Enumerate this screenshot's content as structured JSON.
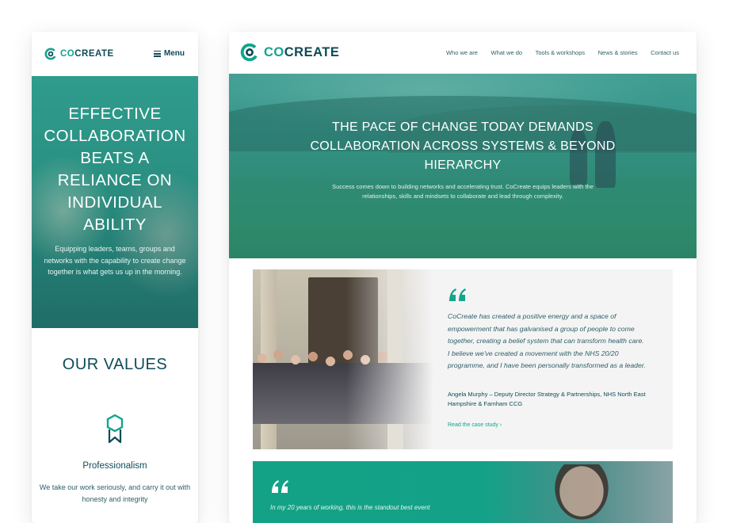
{
  "brand": {
    "logo_co": "CO",
    "logo_create": "CREATE",
    "colors": {
      "teal": "#12a58c",
      "navy": "#0e4b58",
      "hero_overlay": "#2a9082"
    }
  },
  "mobile": {
    "menu_icon": "hamburger-icon",
    "menu_label": "Menu",
    "hero_title": "EFFECTIVE COLLABORATION BEATS A RELIANCE ON INDIVIDUAL ABILITY",
    "hero_subtitle": "Equipping leaders, teams, groups and networks with the capability to create change together is what gets us up in the morning.",
    "values_title": "OUR VALUES",
    "value": {
      "icon": "award-badge-icon",
      "name": "Professionalism",
      "description": "We take our work seriously, and carry it out with honesty and integrity"
    }
  },
  "desktop": {
    "nav": [
      {
        "label": "Who we are"
      },
      {
        "label": "What we do"
      },
      {
        "label": "Tools & workshops"
      },
      {
        "label": "News & stories"
      },
      {
        "label": "Contact us"
      }
    ],
    "hero_title": "THE PACE OF CHANGE TODAY DEMANDS COLLABORATION ACROSS SYSTEMS & BEYOND HIERARCHY",
    "hero_subtitle": "Success comes down to building networks and accelerating trust. CoCreate equips leaders with the relationships, skills and mindsets to collaborate and lead through complexity.",
    "testimonial": {
      "quote": "CoCreate has created a positive energy and a space of empowerment that has galvanised a group of people to come together, creating a belief system that can transform health care. I believe we've created a movement with the NHS 20/20 programme, and I have been personally transformed as a leader.",
      "author": "Angela Murphy – Deputy Director Strategy & Partnerships, NHS North East Hampshire & Farnham CCG",
      "link_label": "Read the case study ›"
    },
    "testimonial2": {
      "text": "In my 20 years of working, this is the standout best event"
    }
  }
}
